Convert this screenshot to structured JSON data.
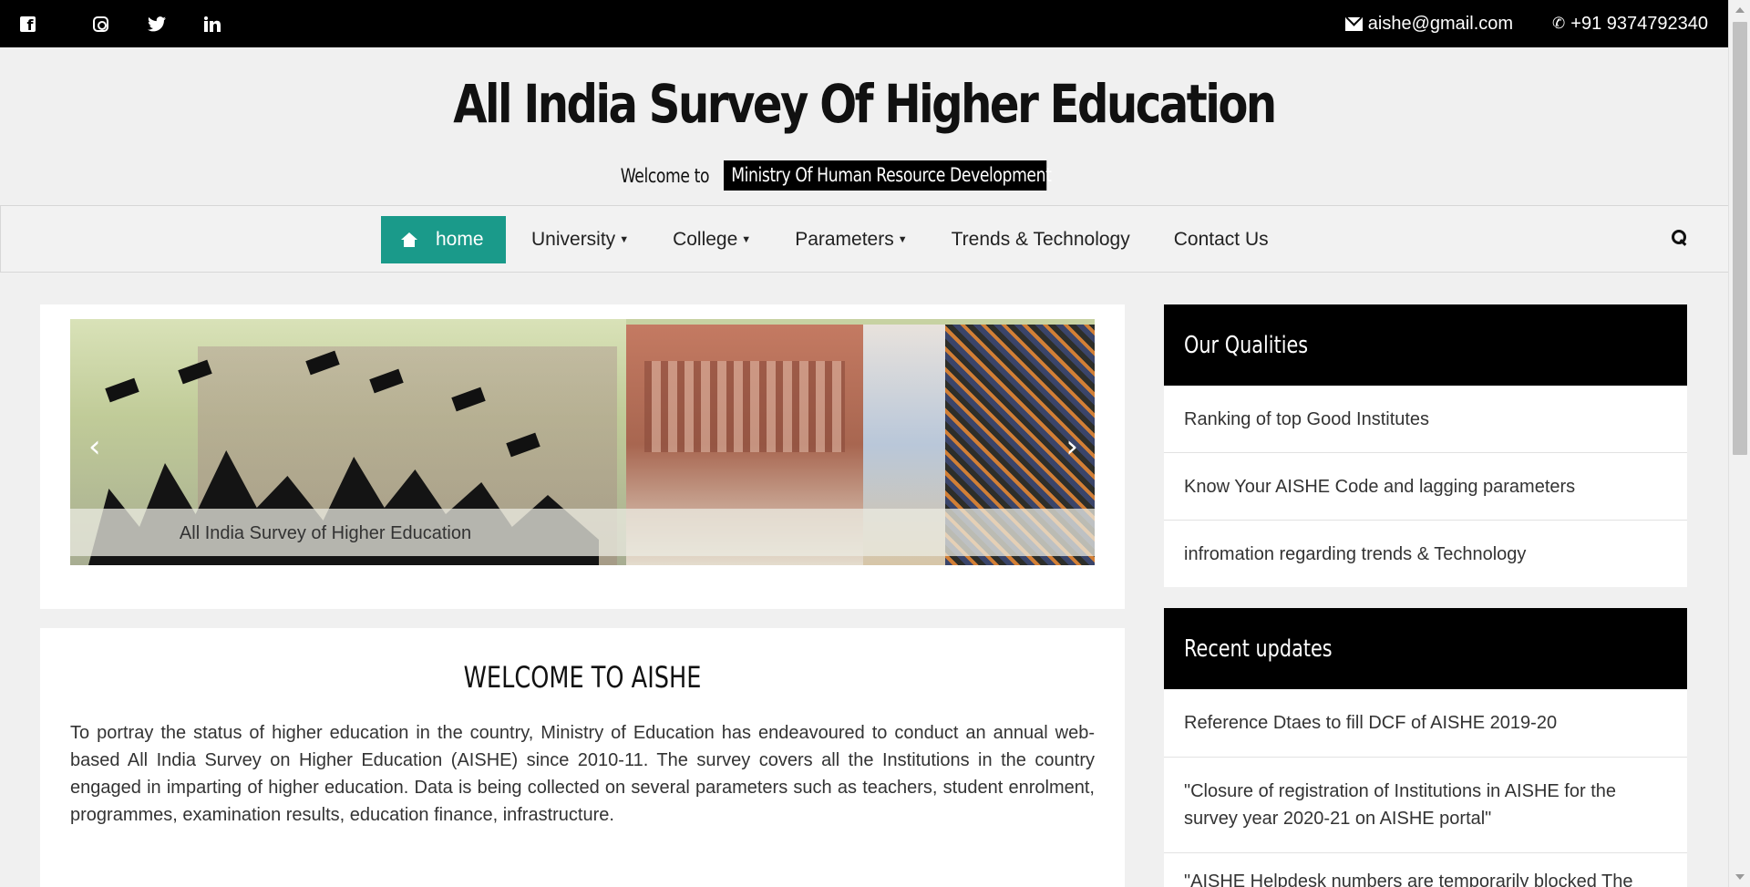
{
  "topbar": {
    "social": [
      "facebook-icon",
      "instagram-icon",
      "twitter-icon",
      "linkedin-icon"
    ],
    "email": "aishe@gmail.com",
    "phone": "+91 9374792340",
    "background_color": "#000000"
  },
  "header": {
    "title": "All India Survey Of Higher Education",
    "welcome_text": "Welcome to",
    "ministry": "Ministry Of Human Resource Development"
  },
  "nav": {
    "accent_color": "#1a9a8a",
    "items": [
      {
        "label": "home",
        "icon": "home-icon",
        "active": true
      },
      {
        "label": "University",
        "dropdown": true
      },
      {
        "label": "College",
        "dropdown": true
      },
      {
        "label": "Parameters",
        "dropdown": true
      },
      {
        "label": "Trends & Technology"
      },
      {
        "label": "Contact Us"
      }
    ],
    "search_icon": "search-icon"
  },
  "slider": {
    "caption": "All India Survey of Higher Education",
    "prev": "‹",
    "next": "›"
  },
  "welcome": {
    "title": "WELCOME TO AISHE",
    "body": "To portray the status of higher education in the country, Ministry of Education has endeavoured to conduct an annual web-based All India Survey on Higher Education (AISHE) since 2010-11. The survey covers all the Institutions in the country engaged in imparting of higher education. Data is being collected on several parameters such as teachers, student enrolment, programmes, examination results, education finance, infrastructure."
  },
  "qualities": {
    "title": "Our Qualities",
    "items": [
      "Ranking of top Good Institutes",
      "Know Your AISHE Code and lagging parameters",
      "infromation regarding trends & Technology"
    ]
  },
  "updates": {
    "title": "Recent updates",
    "items": [
      "Reference Dtaes to fill DCF of AISHE 2019-20",
      "\"Closure of registration of Institutions in AISHE for the survey year 2020-21 on AISHE portal\"",
      "\"AISHE Helpdesk numbers are temporarily blocked The"
    ]
  }
}
